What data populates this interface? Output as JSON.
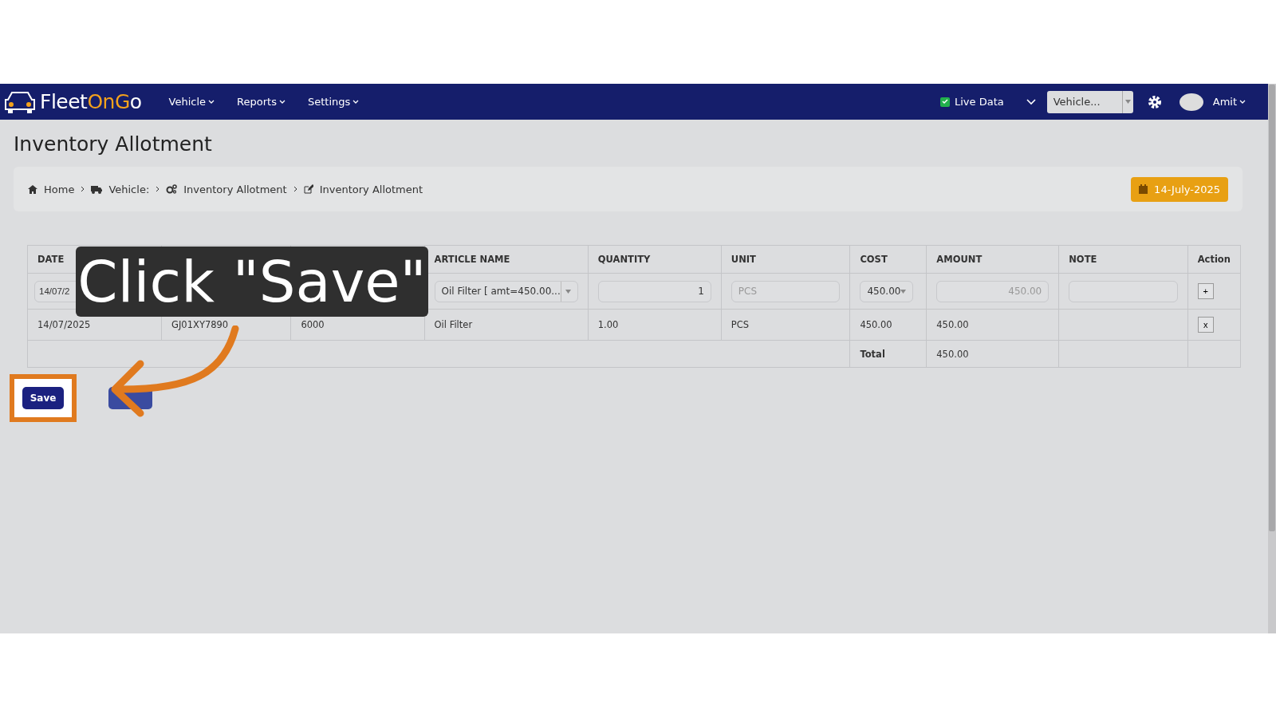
{
  "navbar": {
    "logo": {
      "part1": "Fleet",
      "part2": "On",
      "part3": "G",
      "part4": "o"
    },
    "menus": [
      {
        "label": "Vehicle"
      },
      {
        "label": "Reports"
      },
      {
        "label": "Settings"
      }
    ],
    "live_data": {
      "label": "Live Data",
      "checked": true
    },
    "vehicle_select": {
      "placeholder": "Vehicle..."
    },
    "user": {
      "name": "Amit"
    }
  },
  "page_title": "Inventory Allotment",
  "breadcrumb": [
    {
      "label": "Home"
    },
    {
      "label": "Vehicle:"
    },
    {
      "label": "Inventory Allotment"
    },
    {
      "label": "Inventory Allotment"
    }
  ],
  "date_badge": "14-July-2025",
  "table": {
    "columns": [
      "DATE",
      "",
      "",
      "ARTICLE NAME",
      "QUANTITY",
      "UNIT",
      "COST",
      "AMOUNT",
      "NOTE",
      "Action"
    ],
    "entry_row": {
      "date": "14/07/2",
      "article": "Oil Filter [ amt=450.00...",
      "quantity": "1",
      "unit_placeholder": "PCS",
      "cost": "450.00",
      "amount": "450.00",
      "add": "+"
    },
    "rows": [
      {
        "cells": [
          "14/07/2025",
          "GJ01XY7890",
          "6000",
          "Oil Filter",
          "1.00",
          "PCS",
          "450.00",
          "450.00",
          ""
        ],
        "remove": "x"
      }
    ],
    "total": {
      "label": "Total",
      "value": "450.00"
    }
  },
  "buttons": [
    {
      "label": "Save",
      "highlighted": true
    }
  ],
  "callout": {
    "text": "Click \"Save\""
  }
}
